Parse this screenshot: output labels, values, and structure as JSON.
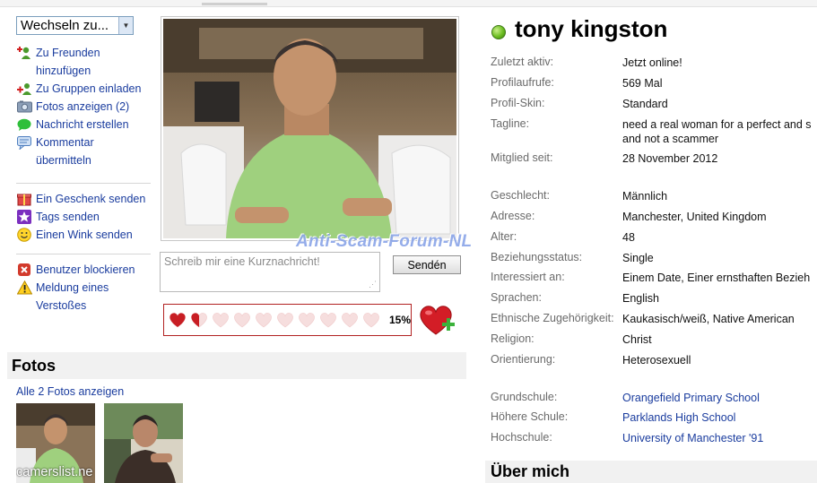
{
  "sidebar": {
    "select_value": "Wechseln zu...",
    "items": [
      {
        "icon": "add-friend-icon",
        "label": "Zu Freunden",
        "label2": "hinzufügen"
      },
      {
        "icon": "group-invite-icon",
        "label": "Zu Gruppen einladen"
      },
      {
        "icon": "photos-icon",
        "label": "Fotos anzeigen (2)"
      },
      {
        "icon": "message-bubble-icon",
        "label": "Nachricht erstellen"
      },
      {
        "icon": "comment-icon",
        "label": "Kommentar",
        "label2": "übermitteln"
      },
      {
        "icon": "gift-icon",
        "label": "Ein Geschenk senden"
      },
      {
        "icon": "star-icon",
        "label": "Tags senden"
      },
      {
        "icon": "smiley-icon",
        "label": "Einen Wink senden"
      },
      {
        "icon": "block-icon",
        "label": "Benutzer blockieren"
      },
      {
        "icon": "warning-icon",
        "label": "Meldung eines",
        "label2": "Verstoßes"
      }
    ]
  },
  "watermark": "Anti-Scam-Forum-NL",
  "quickmessage": {
    "placeholder": "Schreib mir eine Kurznachricht!",
    "send_label": "Sendén"
  },
  "rating": {
    "percent_label": "15%",
    "percent": 15,
    "hearts_total": 10
  },
  "fotos": {
    "title": "Fotos",
    "show_all": "Alle 2 Fotos anzeigen",
    "thumb_watermark": "camerslist.ne"
  },
  "profile": {
    "name": "tony kingston",
    "status_color": "#6cbd22",
    "fields": [
      {
        "key": "Zuletzt aktiv:",
        "value": "Jetzt online!"
      },
      {
        "key": "Profilaufrufe:",
        "value": "569 Mal"
      },
      {
        "key": "Profil-Skin:",
        "value": "Standard"
      },
      {
        "key": "Tagline:",
        "value": "need a real woman for a perfect and s",
        "value2": "and not a scammer"
      },
      {
        "key": "Mitglied seit:",
        "value": "28 November 2012"
      },
      {
        "key": "Geschlecht:",
        "value": "Männlich"
      },
      {
        "key": "Adresse:",
        "value": "Manchester, United Kingdom"
      },
      {
        "key": "Alter:",
        "value": "48"
      },
      {
        "key": "Beziehungsstatus:",
        "value": "Single"
      },
      {
        "key": "Interessiert an:",
        "value": "Einem Date, Einer ernsthaften Bezieh"
      },
      {
        "key": "Sprachen:",
        "value": "English"
      },
      {
        "key": "Ethnische Zugehörigkeit:",
        "value": "Kaukasisch/weiß, Native American"
      },
      {
        "key": "Religion:",
        "value": "Christ"
      },
      {
        "key": "Orientierung:",
        "value": "Heterosexuell"
      },
      {
        "key": "Grundschule:",
        "value": "Orangefield Primary School"
      },
      {
        "key": "Höhere Schule:",
        "value": "Parklands High School"
      },
      {
        "key": "Hochschule:",
        "value": "University of Manchester '91"
      }
    ],
    "about_title": "Über mich"
  },
  "colors": {
    "link": "#1a3c9e",
    "heart": "#c81e24",
    "heart_empty": "#f6dede"
  }
}
